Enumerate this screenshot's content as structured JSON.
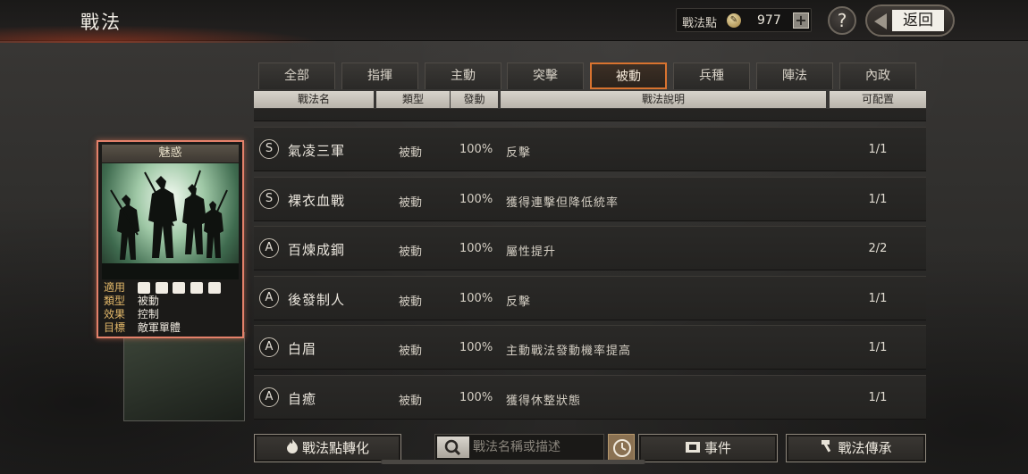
{
  "header": {
    "title": "戰法",
    "points_label": "戰法點",
    "points_value": "977",
    "plus_label": "+",
    "help_label": "?",
    "back_label": "返回"
  },
  "tabs": [
    {
      "label": "全部",
      "active": false
    },
    {
      "label": "指揮",
      "active": false
    },
    {
      "label": "主動",
      "active": false
    },
    {
      "label": "突擊",
      "active": false
    },
    {
      "label": "被動",
      "active": true
    },
    {
      "label": "兵種",
      "active": false
    },
    {
      "label": "陣法",
      "active": false
    },
    {
      "label": "內政",
      "active": false
    }
  ],
  "columns": {
    "name": "戰法名",
    "type": "類型",
    "rate": "發動",
    "desc": "戰法說明",
    "slots": "可配置"
  },
  "rows": [
    {
      "rank": "S",
      "name": "氣凌三軍",
      "type": "被動",
      "rate": "100%",
      "desc": "反擊",
      "slots": "1/1"
    },
    {
      "rank": "S",
      "name": "裸衣血戰",
      "type": "被動",
      "rate": "100%",
      "desc": "獲得連擊但降低統率",
      "slots": "1/1"
    },
    {
      "rank": "A",
      "name": "百煉成鋼",
      "type": "被動",
      "rate": "100%",
      "desc": "屬性提升",
      "slots": "2/2"
    },
    {
      "rank": "A",
      "name": "後發制人",
      "type": "被動",
      "rate": "100%",
      "desc": "反擊",
      "slots": "1/1"
    },
    {
      "rank": "A",
      "name": "白眉",
      "type": "被動",
      "rate": "100%",
      "desc": "主動戰法發動機率提高",
      "slots": "1/1"
    },
    {
      "rank": "A",
      "name": "自癒",
      "type": "被動",
      "rate": "100%",
      "desc": "獲得休整狀態",
      "slots": "1/1"
    }
  ],
  "card": {
    "title": "魅惑",
    "apply_key": "適用",
    "type_key": "類型",
    "type_val": "被動",
    "effect_key": "效果",
    "effect_val": "控制",
    "target_key": "目標",
    "target_val": "敵軍單體",
    "troop_icons": [
      "cavalry-icon",
      "shield-icon",
      "bow-icon",
      "spear-icon",
      "siege-icon"
    ]
  },
  "bottom": {
    "convert_label": "戰法點轉化",
    "search_placeholder": "戰法名稱或描述",
    "events_label": "事件",
    "inherit_label": "戰法傳承"
  },
  "colors": {
    "active_tab_border": "#d9732f",
    "card_border": "#e4816a",
    "stat_key": "#e4b96a"
  }
}
